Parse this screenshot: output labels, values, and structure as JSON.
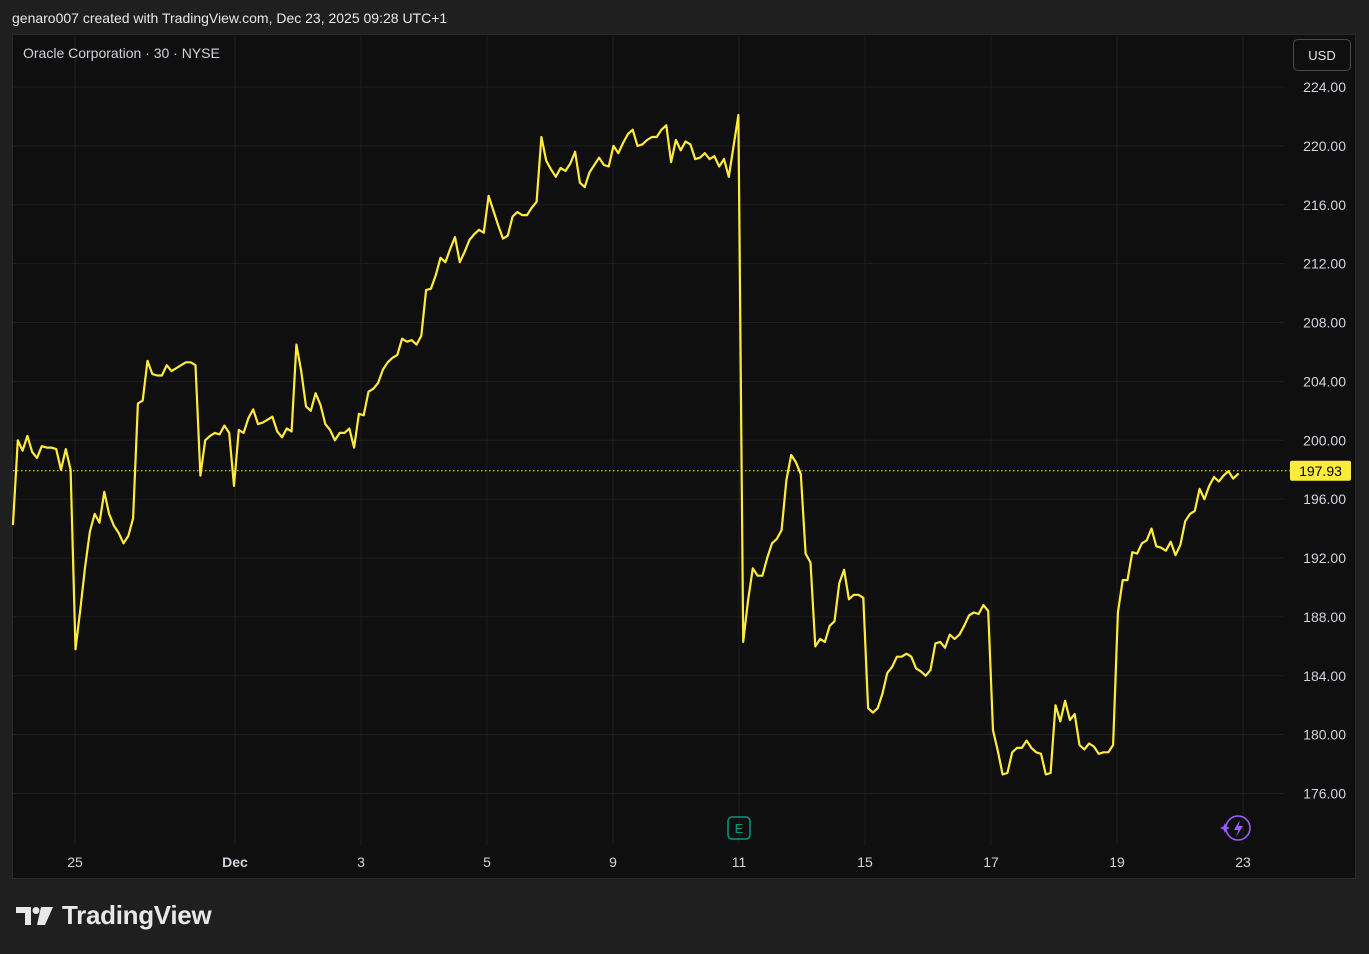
{
  "header": {
    "attribution": "genaro007 created with TradingView.com, Dec 23, 2025 09:28 UTC+1"
  },
  "chart_header": {
    "symbol": "Oracle Corporation · 30 · NYSE",
    "currency": "USD"
  },
  "footer": {
    "brand": "TradingView"
  },
  "colors": {
    "line": "#ffeb3b",
    "background": "#0f0f0f",
    "grid": "#1e1e1e",
    "price_badge_text": "#000000",
    "earnings": "#089981",
    "spark": "#9c5cff"
  },
  "markers": {
    "earnings_label": "E",
    "earnings_icon": "earnings-icon",
    "spark_icon": "lightning-icon"
  },
  "chart_data": {
    "type": "line",
    "title": "",
    "xlabel": "",
    "ylabel": "",
    "ylim": [
      172,
      228
    ],
    "y_ticks": [
      "224.00",
      "220.00",
      "216.00",
      "212.00",
      "208.00",
      "204.00",
      "200.00",
      "196.00",
      "192.00",
      "188.00",
      "184.00",
      "180.00",
      "176.00"
    ],
    "x_ticks": [
      "25",
      "Dec",
      "3",
      "5",
      "9",
      "11",
      "15",
      "17",
      "19",
      "23"
    ],
    "last_price": "197.93",
    "grid": true,
    "values": [
      194.3,
      200.0,
      199.3,
      200.3,
      199.2,
      198.8,
      199.6,
      199.5,
      199.5,
      199.4,
      198.0,
      199.4,
      198.0,
      185.8,
      188.5,
      191.4,
      193.8,
      195.0,
      194.4,
      196.5,
      195.0,
      194.2,
      193.7,
      193.0,
      193.5,
      194.7,
      202.5,
      202.7,
      205.4,
      204.5,
      204.4,
      204.4,
      205.1,
      204.7,
      204.9,
      205.1,
      205.3,
      205.3,
      205.1,
      197.6,
      200.0,
      200.3,
      200.5,
      200.4,
      201.0,
      200.5,
      196.9,
      200.7,
      200.5,
      201.5,
      202.1,
      201.1,
      201.2,
      201.4,
      201.6,
      200.6,
      200.2,
      200.8,
      200.6,
      206.5,
      204.7,
      202.3,
      202.0,
      203.2,
      202.4,
      201.1,
      200.7,
      200.0,
      200.5,
      200.5,
      200.8,
      199.5,
      201.8,
      201.7,
      203.3,
      203.5,
      203.9,
      204.8,
      205.3,
      205.6,
      205.8,
      206.9,
      206.7,
      206.8,
      206.5,
      207.1,
      210.2,
      210.3,
      211.2,
      212.4,
      212.1,
      213.0,
      213.8,
      212.1,
      212.8,
      213.6,
      214.0,
      214.3,
      214.1,
      216.6,
      215.6,
      214.6,
      213.7,
      213.9,
      215.2,
      215.5,
      215.3,
      215.3,
      215.8,
      216.2,
      220.6,
      219.0,
      218.4,
      217.9,
      218.5,
      218.3,
      218.8,
      219.6,
      217.5,
      217.2,
      218.2,
      218.7,
      219.2,
      218.7,
      218.6,
      220.0,
      219.5,
      220.2,
      220.8,
      221.1,
      220.0,
      220.1,
      220.4,
      220.6,
      220.6,
      221.1,
      221.4,
      218.9,
      220.4,
      219.7,
      220.3,
      220.1,
      219.1,
      219.2,
      219.5,
      219.1,
      219.3,
      218.6,
      219.1,
      217.9,
      220.0,
      222.1,
      186.3,
      189.1,
      191.3,
      190.8,
      190.8,
      192.0,
      193.0,
      193.3,
      193.9,
      197.3,
      199.0,
      198.5,
      197.7,
      192.3,
      191.7,
      186.0,
      186.5,
      186.3,
      187.4,
      187.7,
      190.3,
      191.2,
      189.2,
      189.5,
      189.5,
      189.3,
      181.8,
      181.5,
      181.8,
      182.8,
      184.2,
      184.6,
      185.3,
      185.3,
      185.5,
      185.3,
      184.5,
      184.3,
      184.0,
      184.4,
      186.2,
      186.3,
      185.9,
      186.8,
      186.5,
      186.8,
      187.4,
      188.1,
      188.3,
      188.2,
      188.8,
      188.4,
      180.3,
      178.9,
      177.3,
      177.4,
      178.8,
      179.1,
      179.1,
      179.6,
      179.1,
      178.8,
      178.7,
      177.3,
      177.4,
      182.0,
      180.9,
      182.3,
      181.0,
      181.4,
      179.3,
      179.0,
      179.4,
      179.2,
      178.7,
      178.8,
      178.8,
      179.3,
      188.3,
      190.5,
      190.5,
      192.4,
      192.3,
      193.0,
      193.2,
      194.0,
      192.8,
      192.7,
      192.5,
      193.1,
      192.2,
      192.9,
      194.5,
      195.0,
      195.2,
      196.7,
      196.0,
      196.9,
      197.5,
      197.2,
      197.6,
      197.9,
      197.4,
      197.7
    ]
  }
}
